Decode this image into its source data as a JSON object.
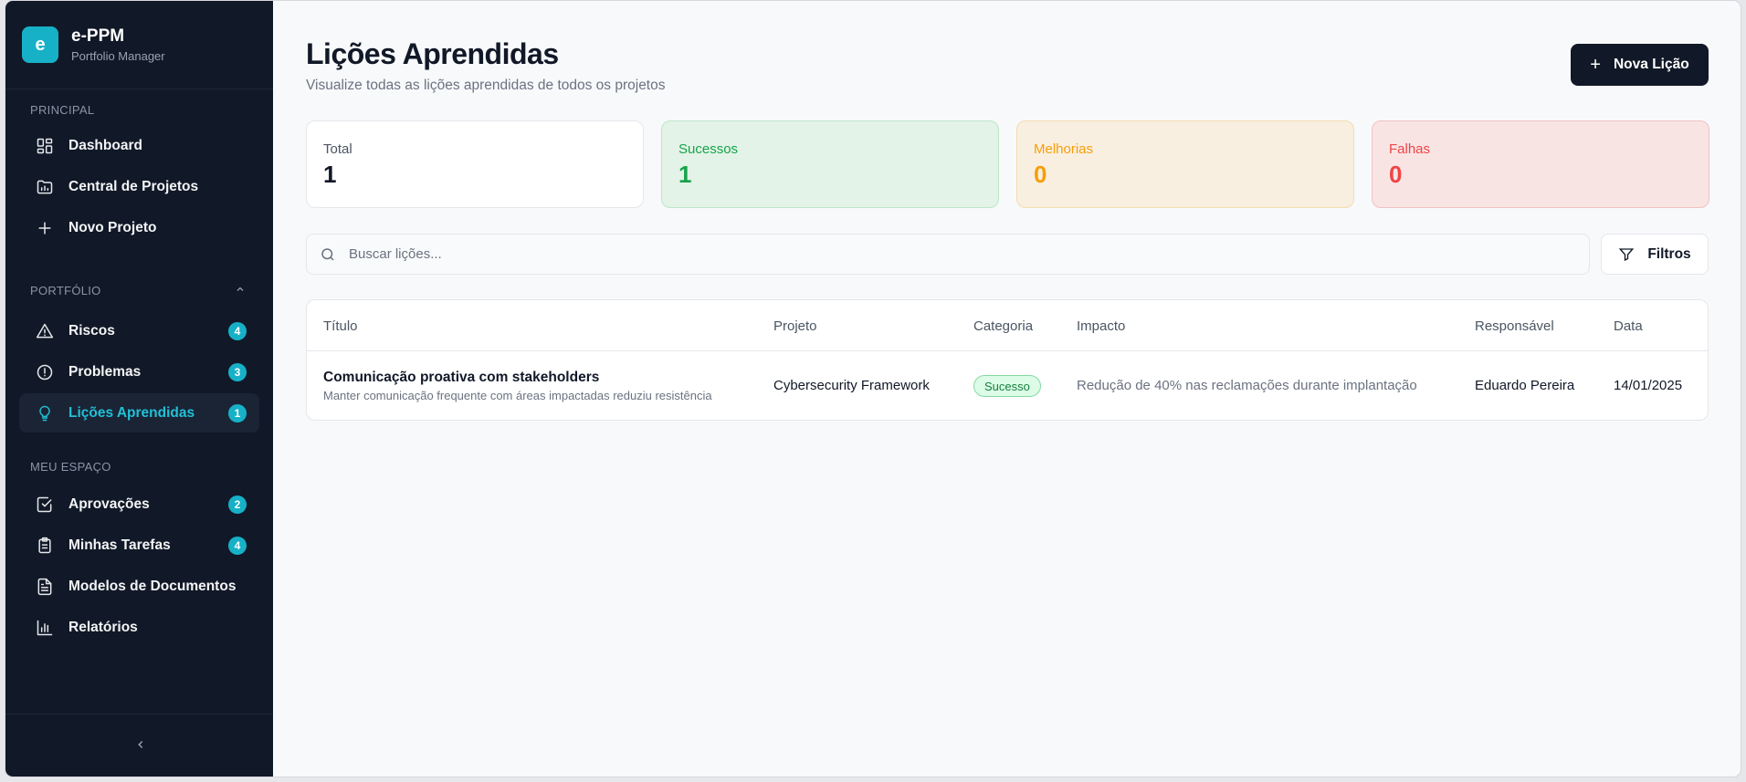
{
  "brand": {
    "logo_letter": "e",
    "name": "e-PPM",
    "subtitle": "Portfolio Manager"
  },
  "sidebar": {
    "sections": [
      {
        "label": "PRINCIPAL"
      },
      {
        "label": "PORTFÓLIO"
      },
      {
        "label": "MEU ESPAÇO"
      }
    ],
    "items": [
      {
        "label": "Dashboard",
        "icon": "dashboard-icon"
      },
      {
        "label": "Central de Projetos",
        "icon": "folder-icon"
      },
      {
        "label": "Novo Projeto",
        "icon": "plus-icon"
      },
      {
        "label": "Riscos",
        "icon": "alert-triangle-icon",
        "badge": "4"
      },
      {
        "label": "Problemas",
        "icon": "alert-circle-icon",
        "badge": "3"
      },
      {
        "label": "Lições Aprendidas",
        "icon": "lightbulb-icon",
        "badge": "1",
        "active": true
      },
      {
        "label": "Aprovações",
        "icon": "check-square-icon",
        "badge": "2"
      },
      {
        "label": "Minhas Tarefas",
        "icon": "clipboard-icon",
        "badge": "4"
      },
      {
        "label": "Modelos de Documentos",
        "icon": "file-text-icon"
      },
      {
        "label": "Relatórios",
        "icon": "bar-chart-icon"
      }
    ]
  },
  "page": {
    "title": "Lições Aprendidas",
    "subtitle": "Visualize todas as lições aprendidas de todos os projetos",
    "new_button": "Nova Lição"
  },
  "stats": [
    {
      "label": "Total",
      "value": "1",
      "color": "#111827",
      "label_color": "#4b5563",
      "bg": "#ffffff",
      "border": "#e5e7eb"
    },
    {
      "label": "Sucessos",
      "value": "1",
      "color": "#16a34a",
      "label_color": "#16a34a",
      "bg": "#e3f3e8",
      "border": "#bde6c9"
    },
    {
      "label": "Melhorias",
      "value": "0",
      "color": "#f59e0b",
      "label_color": "#f59e0b",
      "bg": "#f9efe0",
      "border": "#f3dcae"
    },
    {
      "label": "Falhas",
      "value": "0",
      "color": "#ef4444",
      "label_color": "#ef4444",
      "bg": "#f9e4e4",
      "border": "#f1c2c2"
    }
  ],
  "search": {
    "placeholder": "Buscar lições..."
  },
  "filters_button": "Filtros",
  "table": {
    "headers": [
      "Título",
      "Projeto",
      "Categoria",
      "Impacto",
      "Responsável",
      "Data"
    ],
    "rows": [
      {
        "title": "Comunicação proativa com stakeholders",
        "description": "Manter comunicação frequente com áreas impactadas reduziu resistência",
        "project": "Cybersecurity Framework",
        "category": "Sucesso",
        "impact": "Redução de 40% nas reclamações durante implantação",
        "owner": "Eduardo Pereira",
        "date": "14/01/2025"
      }
    ]
  }
}
